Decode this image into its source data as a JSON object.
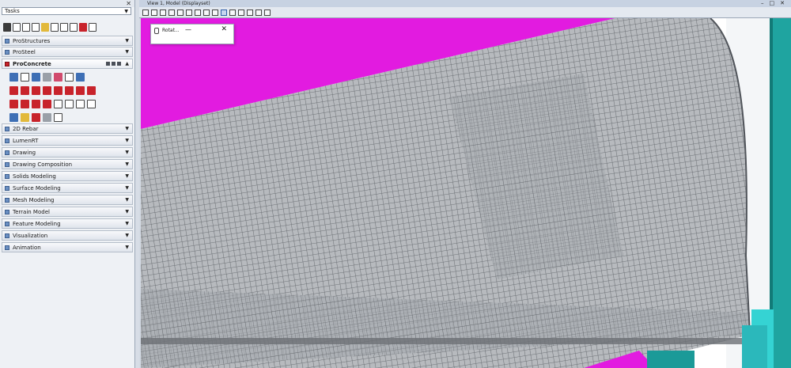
{
  "tasks_panel": {
    "close_glyph": "✕",
    "dropdown_value": "Tasks",
    "sections": [
      {
        "label": "ProStructures",
        "state": "collapsed"
      },
      {
        "label": "ProSteel",
        "state": "collapsed"
      },
      {
        "label": "ProConcrete",
        "state": "expanded"
      },
      {
        "label": "2D Rebar",
        "state": "collapsed"
      },
      {
        "label": "LumenRT",
        "state": "collapsed"
      },
      {
        "label": "Drawing",
        "state": "collapsed"
      },
      {
        "label": "Drawing Composition",
        "state": "collapsed"
      },
      {
        "label": "Solids Modeling",
        "state": "collapsed"
      },
      {
        "label": "Surface Modeling",
        "state": "collapsed"
      },
      {
        "label": "Mesh Modeling",
        "state": "collapsed"
      },
      {
        "label": "Terrain Model",
        "state": "collapsed"
      },
      {
        "label": "Feature Modeling",
        "state": "collapsed"
      },
      {
        "label": "Visualization",
        "state": "collapsed"
      },
      {
        "label": "Animation",
        "state": "collapsed"
      }
    ]
  },
  "view_window": {
    "title": "View 1, Model (Displayset)",
    "controls": {
      "minimize": "–",
      "maximize": "□",
      "close": "✕"
    }
  },
  "rotate_dialog": {
    "title": "Rotat...",
    "minimize": "—",
    "close": "✕"
  },
  "colors": {
    "magenta_surface": "#e21be0",
    "teal_element": "#1fa4a0",
    "cyan_element": "#35d3d3",
    "mesh_gray": "#7b7f84",
    "panel_bg": "#eef1f5",
    "section_icon_blue": "#6a8fc2"
  }
}
